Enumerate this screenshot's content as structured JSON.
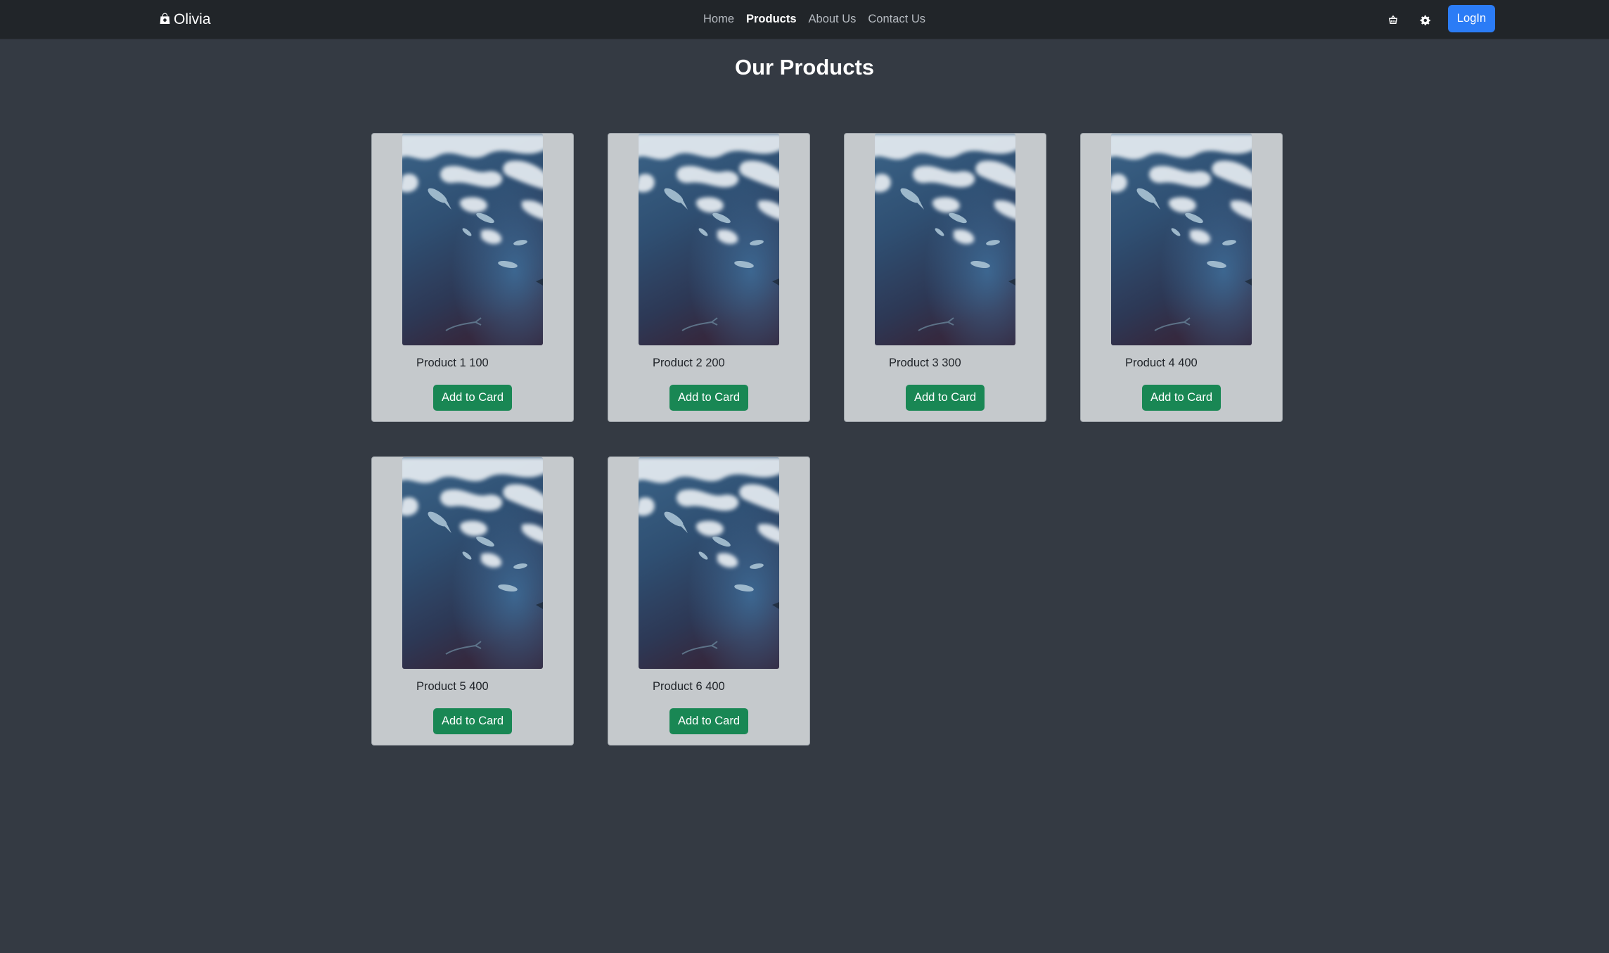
{
  "brand": {
    "name": "Olivia",
    "icon": "shopping-bag-icon"
  },
  "nav": {
    "links": [
      "Home",
      "Products",
      "About Us",
      "Contact Us"
    ],
    "active": "Products"
  },
  "header_icons": [
    "cart-icon",
    "gear-icon"
  ],
  "login_label": "LogIn",
  "page_title": "Our Products",
  "products": [
    {
      "text": "Product 1 100",
      "button": "Add to Card"
    },
    {
      "text": "Product 2 200",
      "button": "Add to Card"
    },
    {
      "text": "Product 3 300",
      "button": "Add to Card"
    },
    {
      "text": "Product 4 400",
      "button": "Add to Card"
    },
    {
      "text": "Product 5 400",
      "button": "Add to Card"
    },
    {
      "text": "Product 6 400",
      "button": "Add to Card"
    }
  ],
  "colors": {
    "background": "#343a43",
    "navbar": "#212529",
    "card": "#c5c9cc",
    "add_button": "#198754",
    "login_button": "#2b7cf6"
  }
}
